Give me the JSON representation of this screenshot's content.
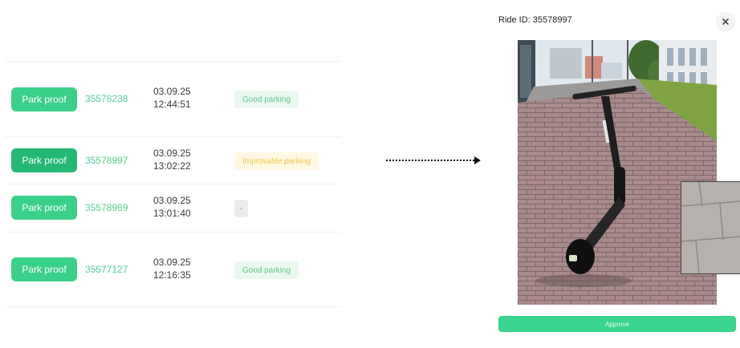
{
  "rides": [
    {
      "button_label": "Park proof",
      "ride_id": "35578238",
      "date": "03.09.25",
      "time": "12:44:51",
      "status": "Good parking",
      "status_type": "good"
    },
    {
      "button_label": "Park proof",
      "ride_id": "35578997",
      "date": "03.09.25",
      "time": "13:02:22",
      "status": "Improvable parking",
      "status_type": "improvable"
    },
    {
      "button_label": "Park proof",
      "ride_id": "35578969",
      "date": "03.09.25",
      "time": "13:01:40",
      "status": "-",
      "status_type": "none"
    },
    {
      "button_label": "Park proof",
      "ride_id": "35577127",
      "date": "03.09.25",
      "time": "12:16:35",
      "status": "Good parking",
      "status_type": "good"
    }
  ],
  "modal": {
    "title": "Ride ID: 35578997",
    "close_icon": "close-icon",
    "approve_label": "Approve"
  },
  "colors": {
    "accent": "#3bd08a",
    "accent_dark": "#25b774",
    "good_bg": "#eaf8ef",
    "improvable_bg": "#fff8e3"
  }
}
